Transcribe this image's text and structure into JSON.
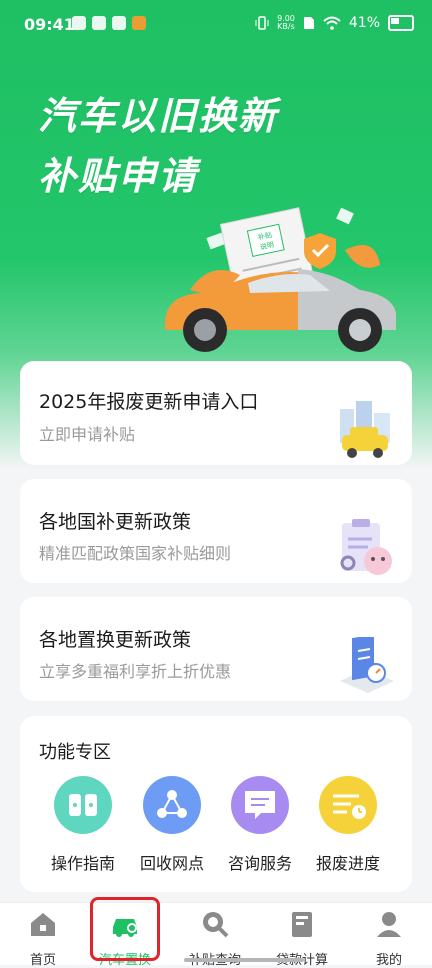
{
  "status_bar": {
    "time": "09:41",
    "speed_value": "9.00",
    "speed_unit": "KB/s",
    "battery_percent": "41%"
  },
  "hero": {
    "title_line1": "汽车以旧换新",
    "title_line2": "补贴申请",
    "doc_stamp_text": "补贴\n说明"
  },
  "cards": [
    {
      "title": "2025年报废更新申请入口",
      "subtitle": "立即申请补贴",
      "icon": "city-car-icon"
    },
    {
      "title": "各地国补更新政策",
      "subtitle": "精准匹配政策国家补贴细则",
      "icon": "clipboard-mascot-icon"
    },
    {
      "title": "各地置换更新政策",
      "subtitle": "立享多重福利享折上折优惠",
      "icon": "document-compass-icon"
    }
  ],
  "features": {
    "heading": "功能专区",
    "items": [
      {
        "label": "操作指南",
        "icon": "book-icon",
        "color": "#5fd6c0"
      },
      {
        "label": "回收网点",
        "icon": "network-icon",
        "color": "#6e9cf5"
      },
      {
        "label": "咨询服务",
        "icon": "chat-icon",
        "color": "#a78bf0"
      },
      {
        "label": "报废进度",
        "icon": "progress-icon",
        "color": "#f6d23a"
      }
    ]
  },
  "bottom_nav": [
    {
      "label": "首页",
      "icon": "home-icon"
    },
    {
      "label": "汽车置换",
      "icon": "car-icon",
      "active": true
    },
    {
      "label": "补贴查询",
      "icon": "search-icon"
    },
    {
      "label": "贷款计算",
      "icon": "book-icon"
    },
    {
      "label": "我的",
      "icon": "user-icon"
    }
  ],
  "colors": {
    "primary_green": "#1fbf64",
    "highlight_red": "#e0242b"
  }
}
